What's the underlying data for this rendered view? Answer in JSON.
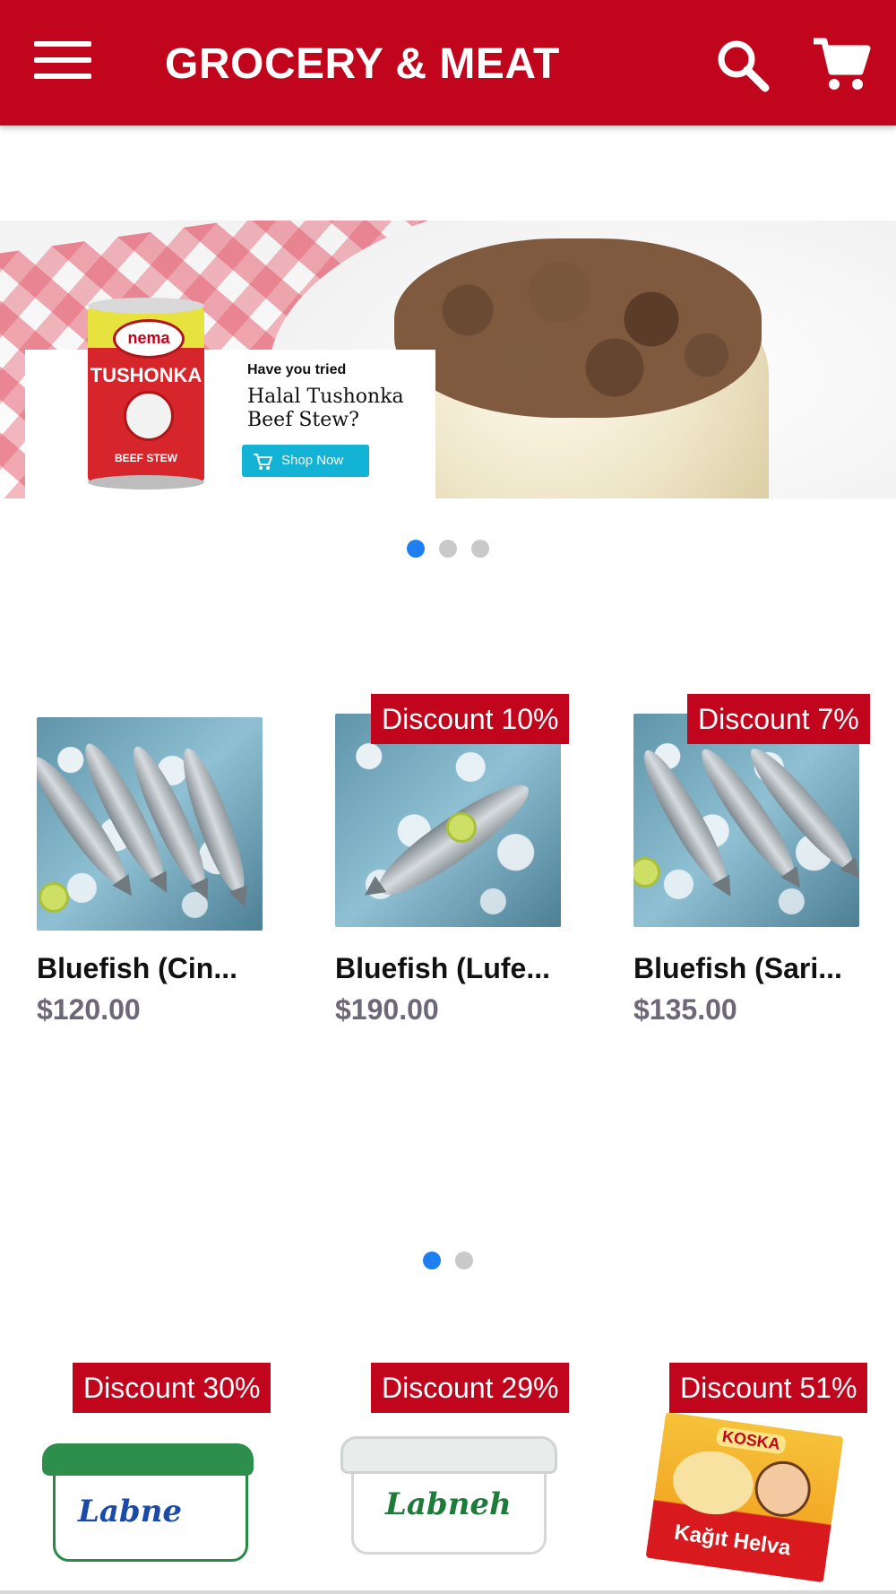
{
  "appbar": {
    "title": "GROCERY & MEAT",
    "menu_icon": "menu-icon",
    "search_icon": "search-icon",
    "cart_icon": "cart-icon",
    "color": "#c0051c"
  },
  "banner": {
    "small_text": "Have you tried",
    "headline": "Halal Tushonka Beef Stew?",
    "button_label": "Shop Now",
    "button_color": "#12b3d4",
    "can_brand": "nema",
    "can_name": "TUSHONKA",
    "can_product": "BEEF STEW",
    "slide_count": 3,
    "active_slide": 0
  },
  "products_row1": [
    {
      "name": "Bluefish (Cin...",
      "price": "$120.00",
      "badge": ""
    },
    {
      "name": "Bluefish (Lufe...",
      "price": "$190.00",
      "badge": "Discount 10%"
    },
    {
      "name": "Bluefish (Sari...",
      "price": "$135.00",
      "badge": "Discount 7%"
    }
  ],
  "row1_pages": 2,
  "row1_active_page": 0,
  "products_row2": [
    {
      "badge": "Discount 30%",
      "label": "Labne"
    },
    {
      "badge": "Discount 29%",
      "label": "Labneh"
    },
    {
      "badge": "Discount 51%",
      "label": "Kağıt Helva",
      "brand": "KOSKA"
    }
  ],
  "colors": {
    "accent": "#c0051c",
    "dot_active": "#1f7ff0",
    "dot_inactive": "#c9c9c9",
    "price": "#6e6777"
  }
}
